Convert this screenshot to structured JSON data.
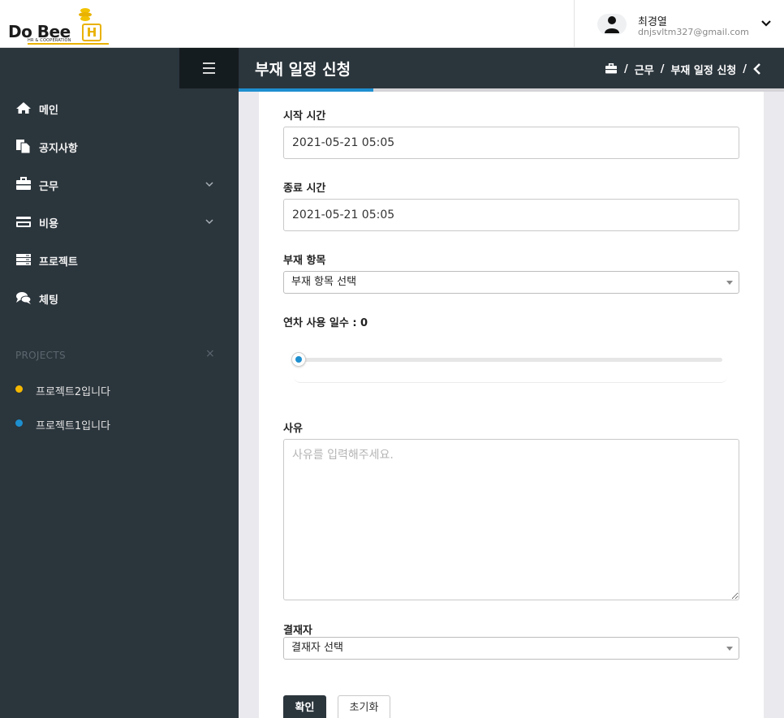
{
  "brand": {
    "logo_text_main": "Do Bee",
    "logo_text_h": "H",
    "logo_tagline": "HR & COOPERATION"
  },
  "user": {
    "name": "최경열",
    "email": "dnjsvltm327@gmail.com"
  },
  "sidebar": {
    "items": [
      {
        "label": "메인",
        "icon": "home-icon"
      },
      {
        "label": "공지사항",
        "icon": "documents-icon"
      },
      {
        "label": "근무",
        "icon": "briefcase-icon",
        "expandable": true
      },
      {
        "label": "비용",
        "icon": "credit-card-icon",
        "expandable": true
      },
      {
        "label": "프로젝트",
        "icon": "server-icon"
      },
      {
        "label": "체팅",
        "icon": "chat-icon"
      }
    ],
    "projects_title": "PROJECTS",
    "projects_close": "×",
    "projects": [
      {
        "label": "프로젝트2입니다",
        "color": "#f5b800"
      },
      {
        "label": "프로젝트1입니다",
        "color": "#1d8fcf"
      }
    ]
  },
  "header": {
    "title": "부재 일정 신청",
    "breadcrumb": [
      "근무",
      "부재 일정 신청"
    ],
    "separator": "/"
  },
  "form": {
    "start_time_label": "시작 시간",
    "start_time_value": "2021-05-21 05:05",
    "end_time_label": "종료 시간",
    "end_time_value": "2021-05-21 05:05",
    "absence_type_label": "부재 항목",
    "absence_type_selected": "부재 항목 선택",
    "leave_days_label": "연차 사용 일수 : 0",
    "leave_days_value": 0,
    "reason_label": "사유",
    "reason_placeholder": "사유를 입력해주세요.",
    "approver_label": "결재자",
    "approver_selected": "결재자 선택",
    "confirm_button": "확인",
    "reset_button": "초기화"
  },
  "colors": {
    "sidebar_bg": "#2b353c",
    "accent": "#1d8fcf",
    "brand_yellow": "#e9b200"
  }
}
